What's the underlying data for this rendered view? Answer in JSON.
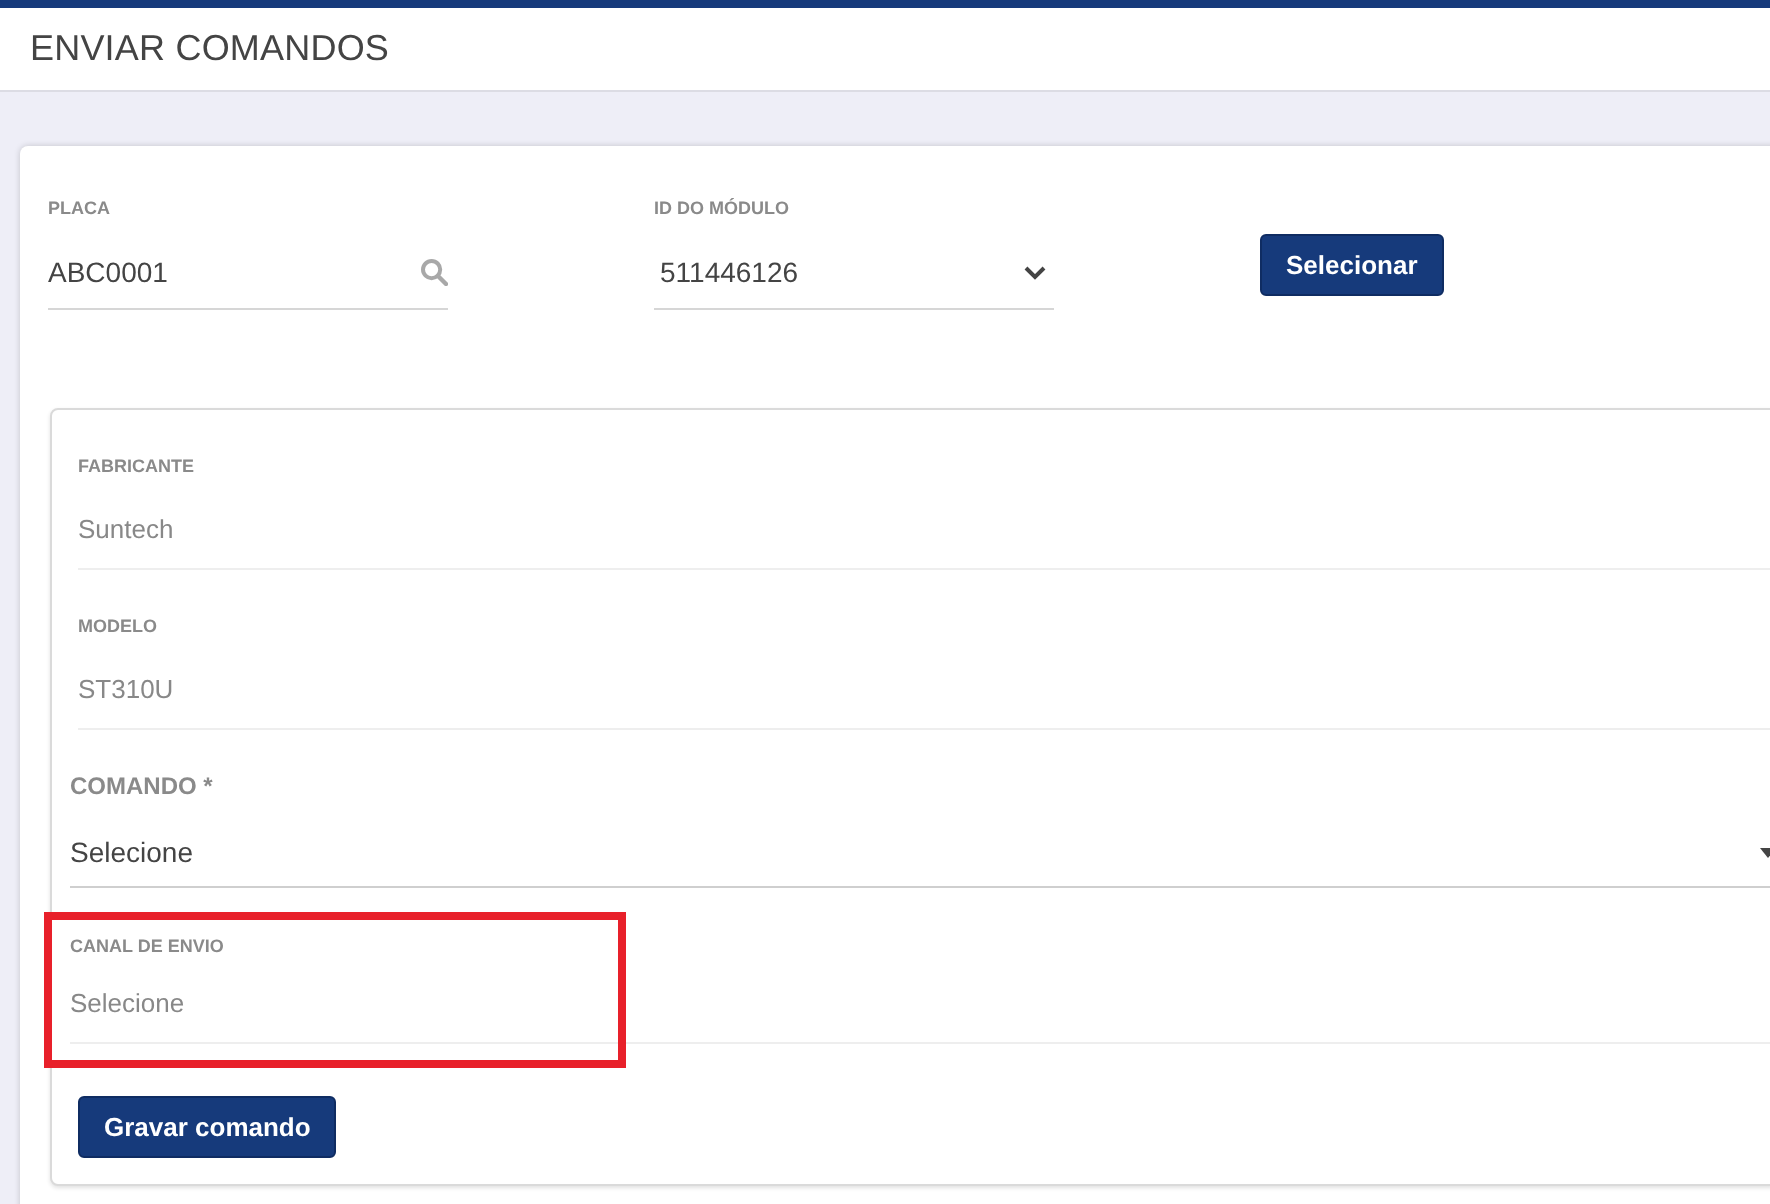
{
  "header": {
    "title": "ENVIAR COMANDOS"
  },
  "lookup": {
    "fields": [
      {
        "kind": "search",
        "label": "PLACA",
        "value": "ABC0001"
      },
      {
        "kind": "select",
        "label": "ID DO MÓDULO",
        "value": "511446126"
      }
    ],
    "button": "Selecionar"
  },
  "device": {
    "info": [
      {
        "label": "FABRICANTE",
        "value": "Suntech"
      },
      {
        "label": "MODELO",
        "value": "ST310U"
      }
    ],
    "command": {
      "label": "COMANDO *",
      "value": "Selecione"
    },
    "channel": {
      "label": "CANAL DE ENVIO",
      "value": "Selecione",
      "highlighted": true
    },
    "button": "Gravar comando"
  }
}
